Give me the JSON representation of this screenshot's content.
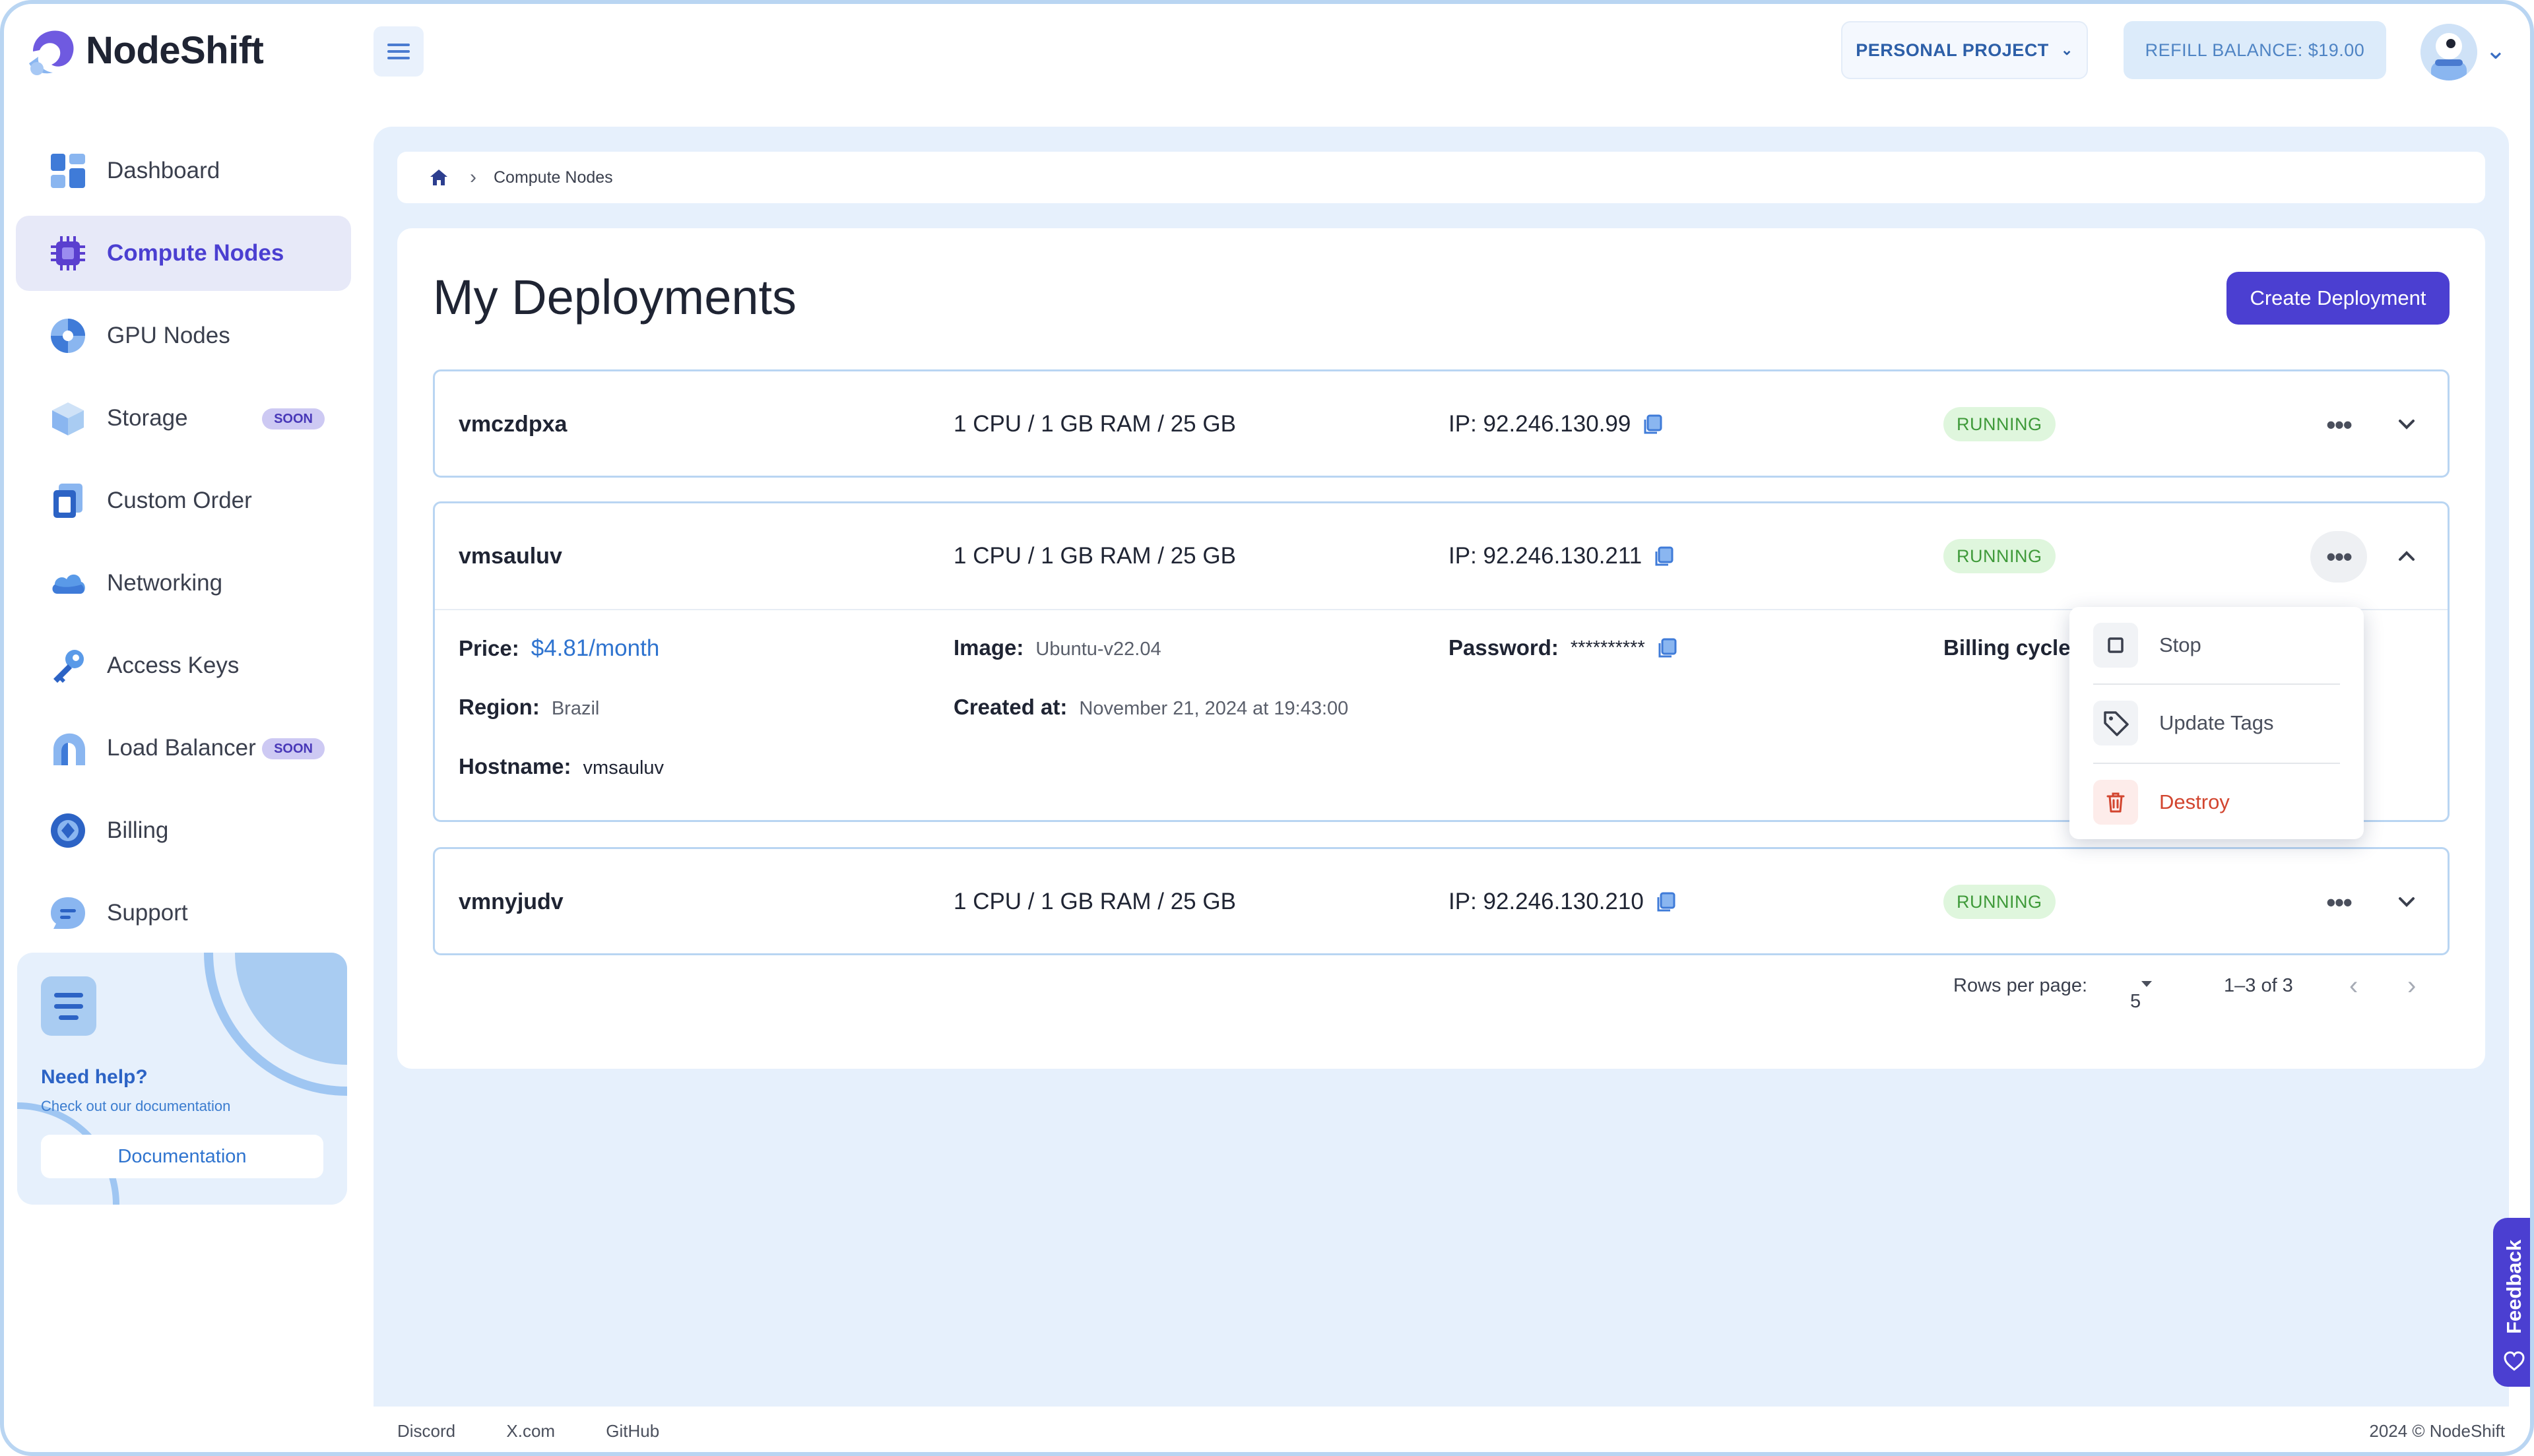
{
  "app": {
    "name": "NodeShift"
  },
  "topbar": {
    "project_label": "PERSONAL PROJECT",
    "refill_label": "REFILL BALANCE: $19.00"
  },
  "sidebar": {
    "items": [
      {
        "label": "Dashboard",
        "icon": "dashboard-icon"
      },
      {
        "label": "Compute Nodes",
        "icon": "chip-icon",
        "active": true
      },
      {
        "label": "GPU Nodes",
        "icon": "gpu-icon"
      },
      {
        "label": "Storage",
        "icon": "storage-cube-icon",
        "badge": "SOON"
      },
      {
        "label": "Custom Order",
        "icon": "custom-order-icon"
      },
      {
        "label": "Networking",
        "icon": "cloud-icon"
      },
      {
        "label": "Access Keys",
        "icon": "key-icon"
      },
      {
        "label": "Load Balancer",
        "icon": "load-balancer-icon",
        "badge": "SOON"
      },
      {
        "label": "Billing",
        "icon": "billing-icon"
      },
      {
        "label": "Support",
        "icon": "chat-icon"
      }
    ],
    "help": {
      "title": "Need help?",
      "subtitle": "Check out our documentation",
      "button": "Documentation"
    }
  },
  "breadcrumb": {
    "current": "Compute Nodes"
  },
  "main": {
    "title": "My Deployments",
    "create_button": "Create Deployment",
    "deployments": [
      {
        "name": "vmczdpxa",
        "spec": "1 CPU / 1 GB RAM / 25 GB",
        "ip": "IP: 92.246.130.99",
        "status": "RUNNING"
      },
      {
        "name": "vmsauluv",
        "spec": "1 CPU / 1 GB RAM / 25 GB",
        "ip": "IP: 92.246.130.211",
        "status": "RUNNING",
        "details": {
          "price_label": "Price:",
          "price": "$4.81/month",
          "image_label": "Image:",
          "image": "Ubuntu-v22.04",
          "password_label": "Password:",
          "password": "**********",
          "billing_label": "Billing cycle:",
          "region_label": "Region:",
          "region": "Brazil",
          "created_label": "Created at:",
          "created": "November 21, 2024 at 19:43:00",
          "hostname_label": "Hostname:",
          "hostname": "vmsauluv"
        }
      },
      {
        "name": "vmnyjudv",
        "spec": "1 CPU / 1 GB RAM / 25 GB",
        "ip": "IP: 92.246.130.210",
        "status": "RUNNING"
      }
    ],
    "pagination": {
      "rows_label": "Rows per page:",
      "rows_value": "5",
      "range": "1–3 of 3"
    }
  },
  "menu": {
    "items": [
      {
        "label": "Stop",
        "icon": "stop-icon"
      },
      {
        "label": "Update Tags",
        "icon": "tag-icon"
      },
      {
        "label": "Destroy",
        "icon": "trash-icon",
        "color": "#d2452f"
      }
    ]
  },
  "footer": {
    "links": [
      "Discord",
      "X.com",
      "GitHub"
    ],
    "copyright": "2024 © NodeShift"
  },
  "feedback": {
    "label": "Feedback"
  },
  "colors": {
    "accent": "#4b3fd1",
    "link": "#2e73cf",
    "running_bg": "#dff6dd",
    "running_text": "#3f9a3a"
  }
}
